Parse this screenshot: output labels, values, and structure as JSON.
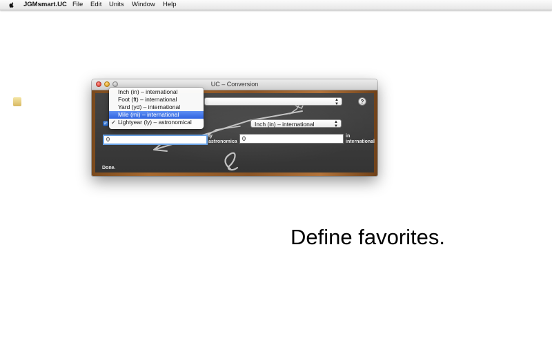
{
  "menubar": {
    "icon": "apple-icon",
    "app_name": "JGMsmart.UC",
    "items": [
      "File",
      "Edit",
      "Units",
      "Window",
      "Help"
    ]
  },
  "window": {
    "title": "UC – Conversion",
    "controls": [
      "close-icon",
      "minimize-icon",
      "zoom-icon"
    ],
    "favorites_checked": true,
    "help_label": "?",
    "target_unit_popup": {
      "selected": "Inch (in) – international"
    },
    "input_value": "0",
    "input_unit_label": "ly astronomica",
    "output_value": "0",
    "output_unit_label": "in international",
    "status": "Done."
  },
  "dropdown": {
    "items": [
      {
        "label": "Inch (in) – international",
        "checked": false,
        "highlighted": false
      },
      {
        "label": "Foot (ft) – international",
        "checked": false,
        "highlighted": false
      },
      {
        "label": "Yard (yd) – international",
        "checked": false,
        "highlighted": false
      },
      {
        "label": "Mile (mi) – international",
        "checked": false,
        "highlighted": true
      },
      {
        "label": "Lightyear (ly) – astronomical",
        "checked": true,
        "highlighted": false
      }
    ],
    "check_glyph": "✓"
  },
  "caption": "Define favorites.",
  "colors": {
    "highlight": "#3a6ee6",
    "chalkboard": "#3d3d3d",
    "frame": "#8a5425"
  }
}
